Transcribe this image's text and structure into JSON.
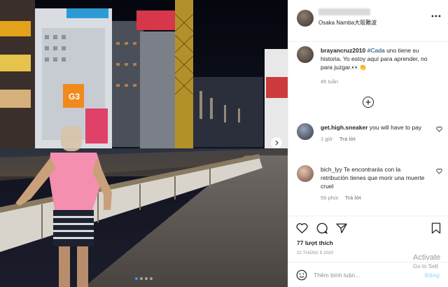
{
  "post": {
    "location": "Osaka Namba大阪難波",
    "more_icon": "more-horizontal-icon"
  },
  "photo": {
    "signs": {
      "g3": "G3"
    },
    "carousel_next_icon": "chevron-right-icon",
    "carousel_dot_count": 4,
    "carousel_active_index": 0
  },
  "caption": {
    "username": "brayancruz2010",
    "hashtag": "#Cada",
    "text": " uno tiene su historia. Yo estoy aquí para aprender, no para juzgar.👀👏",
    "time": "45 tuần"
  },
  "load_more_icon": "plus-circle-icon",
  "comments": [
    {
      "username": "get.high.sneaker",
      "text": " you will have to pay",
      "time": "1 giờ",
      "reply": "Trả lời"
    },
    {
      "username": "bich_lyy",
      "text": " Te encontrarás con la retribución tienes que morir una muerte cruel",
      "time": "59 phút",
      "reply": "Trả lời"
    }
  ],
  "actions": {
    "likes": "77 lượt thích",
    "date": "22 THÁNG 9 2020"
  },
  "add_comment": {
    "placeholder": "Thêm bình luận...",
    "post_label": "Đăng"
  },
  "watermark": {
    "line1": "Activate",
    "line2": "Go to Sett"
  },
  "colors": {
    "link_blue": "#00376b",
    "post_button_disabled": "#b2dffc",
    "muted_text": "#8e8e8e"
  }
}
